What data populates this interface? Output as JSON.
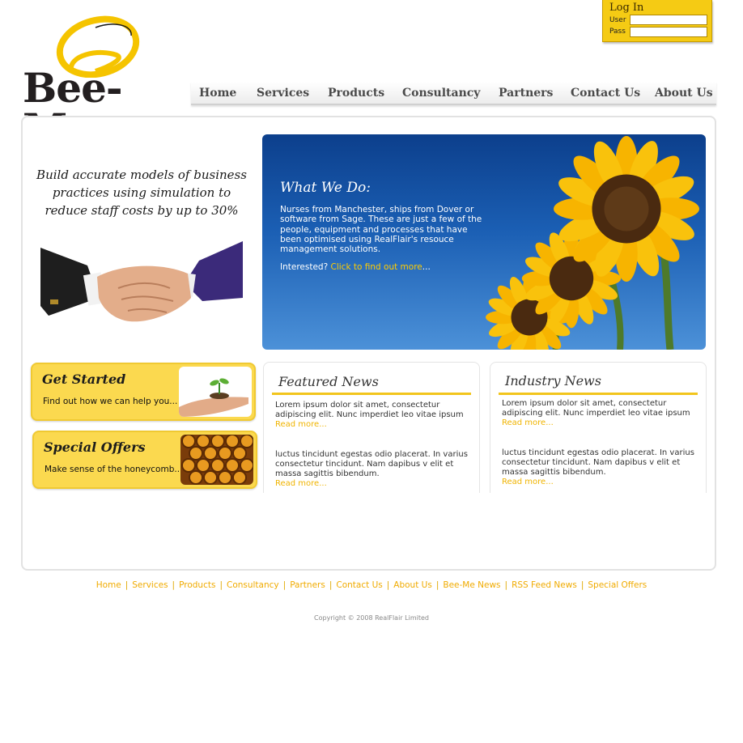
{
  "brand": {
    "logo_text": "Bee-Me"
  },
  "login": {
    "title": "Log In",
    "user_label": "User",
    "pass_label": "Pass",
    "user_value": "",
    "pass_value": ""
  },
  "nav": [
    "Home",
    "Services",
    "Products",
    "Consultancy",
    "Partners",
    "Contact Us",
    "About Us"
  ],
  "tagline": [
    "Build accurate models of business",
    "practices using simulation to",
    "reduce staff costs by up to 30%"
  ],
  "hero": {
    "title": "What We Do:",
    "text": "Nurses from Manchester, ships from Dover or software from Sage. These are just a few of the people, equipment and processes that have been optimised using RealFlair's resouce management solutions.",
    "cta_prefix": "Interested?",
    "cta_link": "Click to find out more",
    "cta_suffix": "..."
  },
  "promos": [
    {
      "title": "Get Started",
      "subtitle": "Find out how we can help you..."
    },
    {
      "title": "Special Offers",
      "subtitle": "Make sense of the honeycomb..."
    }
  ],
  "news": {
    "featured": {
      "title": "Featured News",
      "items": [
        {
          "text": "Lorem ipsum dolor sit amet, consectetur adipiscing elit. Nunc imperdiet leo vitae ipsum",
          "more": "Read more..."
        },
        {
          "text": "luctus tincidunt egestas odio placerat. In varius consectetur tincidunt. Nam dapibus v elit et massa sagittis bibendum.",
          "more": "Read more..."
        }
      ]
    },
    "industry": {
      "title": "Industry News",
      "items": [
        {
          "text": "Lorem ipsum dolor sit amet, consectetur adipiscing elit. Nunc imperdiet leo vitae ipsum",
          "more": "Read more..."
        },
        {
          "text": "luctus tincidunt egestas odio placerat. In varius consectetur tincidunt. Nam dapibus v elit et massa sagittis bibendum.",
          "more": "Read more..."
        }
      ]
    }
  },
  "footer": {
    "links": [
      "Home",
      "Services",
      "Products",
      "Consultancy",
      "Partners",
      "Contact Us",
      "About Us",
      "Bee-Me News",
      "RSS Feed News",
      "Special Offers"
    ],
    "separator": "|",
    "copyright": "Copyright © 2008 RealFlair Limited"
  },
  "colors": {
    "accent": "#f5cb14",
    "link": "#f0ab00",
    "hero_blue": "#1b5fb4"
  }
}
